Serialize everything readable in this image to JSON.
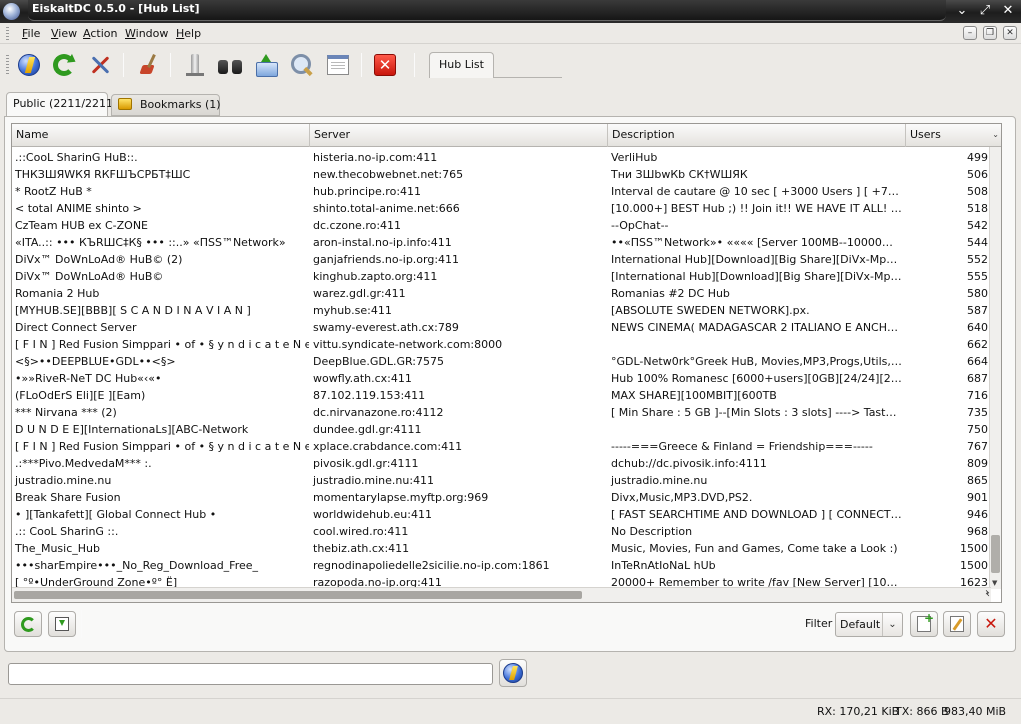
{
  "window": {
    "title": "EiskaltDC 0.5.0 - [Hub List]"
  },
  "menu": [
    "File",
    "View",
    "Action",
    "Window",
    "Help"
  ],
  "toolbar": {
    "doc_tab": "Hub List"
  },
  "tabs": {
    "public": "Public (2211/2211)",
    "bookmarks": "Bookmarks (1)"
  },
  "table": {
    "columns": [
      "Name",
      "Server",
      "Description",
      "Users"
    ],
    "rows": [
      {
        "name": ".::CooL SharinG HuB::.",
        "server": "histeria.no-ip.com:411",
        "desc": "VerliHub",
        "users": "499"
      },
      {
        "name": "ТНКЗШЯWКЯ RКFШЪСРБТ‡ШС",
        "server": "new.thecobwebnet.net:765",
        "desc": "Тни ЗШbwКb СК†WШЯК",
        "users": "506"
      },
      {
        "name": "* RootZ HuB *",
        "server": "hub.principe.ro:411",
        "desc": "Interval de cautare @ 10 sec [ +3000 Users ] [ +70 TiB ]",
        "users": "508"
      },
      {
        "name": "< total ANIME shinto >",
        "server": "shinto.total-anime.net:666",
        "desc": " [10.000+] BEST Hub ;) !! Join it!! WE HAVE IT ALL! Game...",
        "users": "518"
      },
      {
        "name": "CzTeam HUB ex C-ZONE",
        "server": "dc.czone.ro:411",
        "desc": "--OpChat--",
        "users": "542"
      },
      {
        "name": "«ITA..:: ••• КЪRШС‡К§ ••• ::..» «ΠSS™Network»",
        "server": "aron-instal.no-ip.info:411",
        "desc": "••«ΠSS™Network»• «««« [Server 100MB--10000+ users] ...",
        "users": "544"
      },
      {
        "name": "DiVx™ DoWnLoAd® HuB© (2)",
        "server": "ganjafriends.no-ip.org:411",
        "desc": "International Hub][Download][Big Share][DiVx-Mp3-News-...",
        "users": "552"
      },
      {
        "name": "DiVx™ DoWnLoAd® HuB©",
        "server": "kinghub.zapto.org:411",
        "desc": "[International Hub][Download][Big Share][DiVx-Mp3-News-...",
        "users": "555"
      },
      {
        "name": "Romania 2 Hub",
        "server": "warez.gdl.gr:411",
        "desc": "Romanias #2 DC Hub",
        "users": "580"
      },
      {
        "name": "[MYHUB.SE][BBB][ S C A N D I N A V I A N ]",
        "server": "myhub.se:411",
        "desc": "[ABSOLUTE SWEDEN NETWORK].px.",
        "users": "587"
      },
      {
        "name": "Direct Connect Server",
        "server": "swamy-everest.ath.cx:789",
        "desc": "NEWS CINEMA( MADAGASCAR 2 ITALIANO E ANCHE INGL...",
        "users": "640"
      },
      {
        "name": "[ F I N ] Red Fusion Simppari • of • § y n d i c a t e  N e t ...",
        "server": "vittu.syndicate-network.com:8000",
        "desc": "",
        "users": "662"
      },
      {
        "name": "<§>••DEEPBLUE•GDL••<§>",
        "server": "DeepBlue.GDL.GR:7575",
        "desc": "°GDL-Netw0rk°Greek HuB, Movies,MP3,Progs,Utils, iso, He...",
        "users": "664"
      },
      {
        "name": "•»»RiveR-NeT DC Hub«‹«•",
        "server": "wowfly.ath.cx:411",
        "desc": "Hub 100% Romanesc [6000+users][0GB][24/24][200TB+]",
        "users": "687"
      },
      {
        "name": "(FLoOdErS Eli][E ][Eam)",
        "server": "87.102.119.153:411",
        "desc": "MAX SHARE][100MBIT][600TB",
        "users": "716"
      },
      {
        "name": "*** Nirvana *** (2)",
        "server": "dc.nirvanazone.ro:4112",
        "desc": "[ Min Share : 5 GB ]--[Min Slots : 3 slots] ---->  Tastati  /fa...",
        "users": "735"
      },
      {
        "name": "D U N D E E][InternationaLs][ABC-Network",
        "server": "dundee.gdl.gr:4111",
        "desc": "",
        "users": "750"
      },
      {
        "name": "[ F I N ] Red Fusion Simppari • of • § y n d i c a t e  N e t ...",
        "server": "xplace.crabdance.com:411",
        "desc": "-----===Greece & Finland = Friendship===-----",
        "users": "767"
      },
      {
        "name": " .:***Pivo.MedvedaM*** :.",
        "server": "pivosik.gdl.gr:4111",
        "desc": "dchub://dc.pivosik.info:4111",
        "users": "809"
      },
      {
        "name": "justradio.mine.nu",
        "server": "justradio.mine.nu:411",
        "desc": "justradio.mine.nu",
        "users": "865"
      },
      {
        "name": " Break Share Fusion",
        "server": "momentarylapse.myftp.org:969",
        "desc": "Divx,Music,MP3.DVD,PS2.",
        "users": "901"
      },
      {
        "name": "• ][Tankafett][ Global Connect Hub •",
        "server": "worldwidehub.eu:411",
        "desc": "[ FAST SEARCHTIME AND DOWNLOAD ] [ CONNECT NOW ...",
        "users": "946"
      },
      {
        "name": ".:: CooL SharinG ::.",
        "server": "cool.wired.ro:411",
        "desc": "No Description",
        "users": "968"
      },
      {
        "name": "The_Music_Hub",
        "server": "thebiz.ath.cx:411",
        "desc": "Music, Movies, Fun and Games, Come take a Look :)",
        "users": "1500"
      },
      {
        "name": "•••sharEmpire•••_No_Reg_Download_Free_",
        "server": "regnodinapoliedelle2sicilie.no-ip.com:1861",
        "desc": "InTeRnAtIoNaL hUb",
        "users": "1500"
      },
      {
        "name": "[ °º•UnderGround Zone•º° Ё]",
        "server": "razopoda.no-ip.org:411",
        "desc": "20000+ Remember to write /fav [New Server] [10GB]SLO]",
        "users": "1623"
      }
    ]
  },
  "filter": {
    "label": "Filter",
    "value": "Default"
  },
  "status": {
    "rx": "RX: 170,21 KiB",
    "tx": "TX: 866 B",
    "share": "983,40 MiB"
  }
}
